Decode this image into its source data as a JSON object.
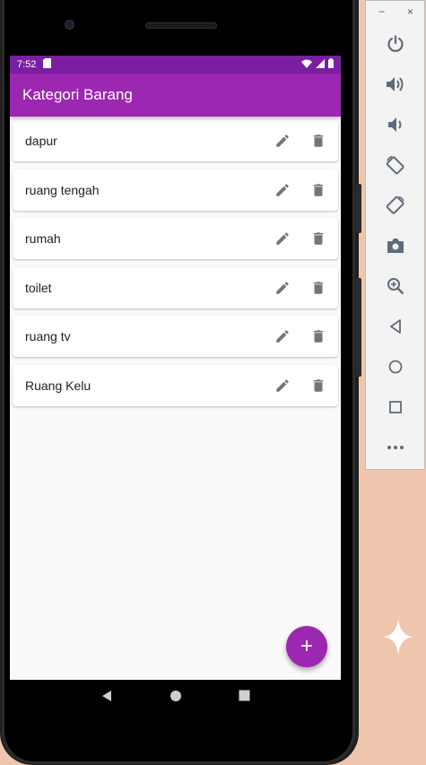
{
  "colors": {
    "primary": "#9c27b0",
    "primary_dark": "#7b1fa2",
    "icon_grey": "#757575",
    "background": "#efc6ad"
  },
  "statusbar": {
    "time": "7:52",
    "icons": [
      "sd-card-icon",
      "wifi-icon",
      "signal-icon",
      "battery-icon"
    ]
  },
  "appbar": {
    "title": "Kategori Barang"
  },
  "categories": [
    {
      "label": "dapur"
    },
    {
      "label": "ruang tengah"
    },
    {
      "label": "rumah"
    },
    {
      "label": "toilet"
    },
    {
      "label": "ruang tv"
    },
    {
      "label": "Ruang Kelu"
    }
  ],
  "item_actions": [
    "edit-icon",
    "delete-icon"
  ],
  "fab": {
    "label": "+"
  },
  "navbar": [
    "back-icon",
    "home-icon",
    "recents-icon"
  ],
  "emulator_toolbar": {
    "minimize": "−",
    "close": "×",
    "items": [
      "power-icon",
      "volume-up-icon",
      "volume-down-icon",
      "rotate-left-icon",
      "rotate-right-icon",
      "camera-icon",
      "zoom-icon",
      "back-icon",
      "home-icon",
      "overview-icon",
      "more-icon"
    ]
  }
}
